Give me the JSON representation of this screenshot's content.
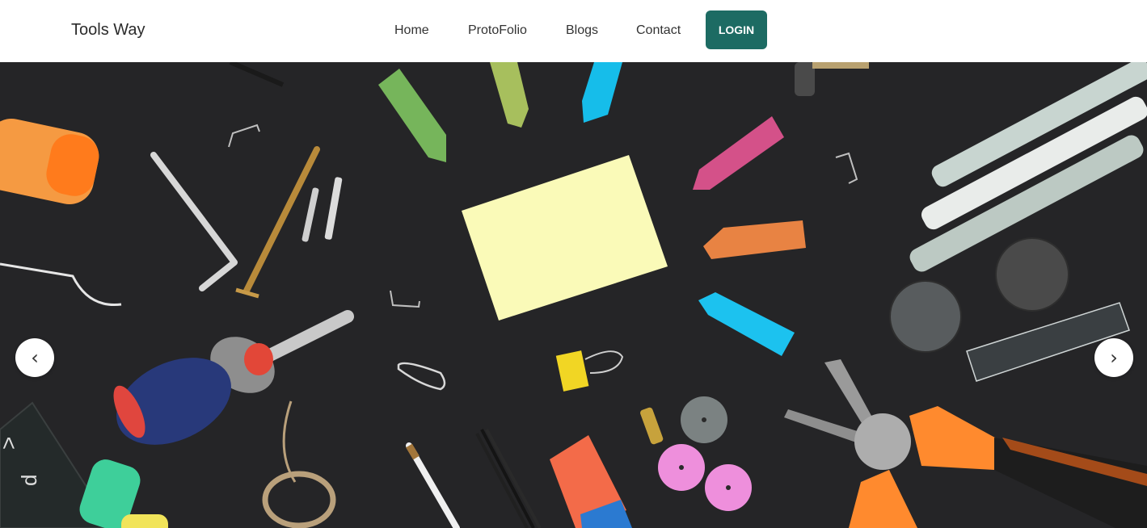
{
  "navbar": {
    "brand": "Tools Way",
    "links": [
      "Home",
      "ProtoFolio",
      "Blogs",
      "Contact"
    ],
    "login_label": "LOGIN"
  },
  "carousel": {
    "prev_icon": "‹",
    "next_icon": "›"
  },
  "colors": {
    "login_bg": "#1d6b63",
    "hero_bg": "#252527"
  }
}
